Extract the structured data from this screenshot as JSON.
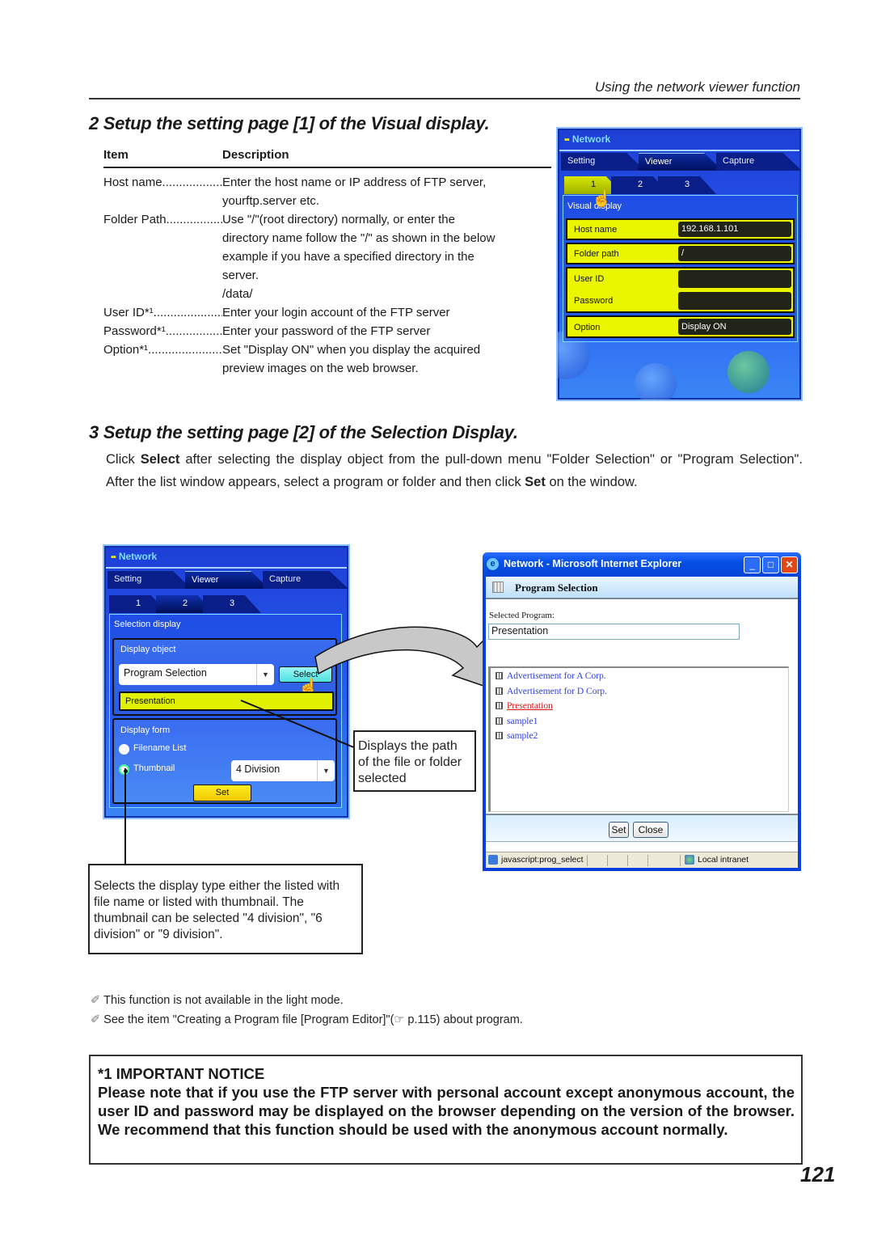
{
  "header": {
    "running_head": "Using the network viewer function"
  },
  "section2": {
    "title": "2 Setup the setting page [1] of the Visual display.",
    "table": {
      "headers": [
        "Item",
        "Description"
      ],
      "rows": [
        {
          "item": "Host name",
          "lines": [
            "Enter the host name or IP address of FTP server,",
            "yourftp.server etc."
          ]
        },
        {
          "item": "Folder Path",
          "lines": [
            "Use \"/\"(root directory) normally, or enter the",
            "directory name follow the \"/\" as shown in the below",
            "example if you have a specified directory in the",
            "server.",
            "/data/"
          ]
        },
        {
          "item": "User ID*¹",
          "lines": [
            "Enter your login account of the FTP server"
          ]
        },
        {
          "item": "Password*¹",
          "lines": [
            "Enter your password of the FTP server"
          ]
        },
        {
          "item": "Option*¹",
          "lines": [
            "Set \"Display ON\" when you display the acquired",
            "preview images on the web browser."
          ]
        }
      ]
    },
    "panel": {
      "title": "Network",
      "tabs": [
        "Setting",
        "Viewer",
        "Capture"
      ],
      "active_tab": "Viewer",
      "subtabs": [
        "1",
        "2",
        "3"
      ],
      "active_subtab": "1",
      "section_label": "Visual display",
      "fields": [
        {
          "label": "Host name",
          "value": "192.168.1.101"
        },
        {
          "label": "Folder path",
          "value": "/"
        },
        {
          "label": "User ID",
          "value": ""
        },
        {
          "label": "Password",
          "value": ""
        },
        {
          "label": "Option",
          "value": "Display ON"
        }
      ]
    }
  },
  "section3": {
    "title": "3 Setup the setting page [2] of the Selection Display.",
    "paragraph": {
      "p1": "Click ",
      "b1": "Select",
      "p2": " after selecting the display object from the pull-down menu \"Folder Selection\" or \"Program Selection\". After the list window appears, select a program or folder and then click ",
      "b2": "Set",
      "p3": " on the window."
    },
    "panel": {
      "title": "Network",
      "tabs": [
        "Setting",
        "Viewer",
        "Capture"
      ],
      "active_tab": "Viewer",
      "subtabs": [
        "1",
        "2",
        "3"
      ],
      "active_subtab": "2",
      "section_label": "Selection display",
      "display_object_label": "Display object",
      "display_object_value": "Program Selection",
      "select_button": "Select",
      "path_value": "Presentation",
      "display_form_label": "Display form",
      "radio_filename": "Filename List",
      "radio_thumbnail": "Thumbnail",
      "selected_radio": "Thumbnail",
      "division_value": "4 Division",
      "set_button": "Set"
    },
    "callout_path": "Displays the path of the file or folder selected",
    "callout_display": "Selects the display type either the listed with file name or listed with thumbnail. The thumbnail can be selected \"4 division\", \"6 division\" or \"9 division\".",
    "ie_window": {
      "title": "Network - Microsoft Internet Explorer",
      "heading": "Program Selection",
      "selected_label": "Selected Program:",
      "selected_value": "Presentation",
      "items": [
        "Advertisement for A Corp.",
        "Advertisement for D Corp.",
        "Presentation",
        "sample1",
        "sample2"
      ],
      "selected_item": "Presentation",
      "set_button": "Set",
      "close_button": "Close",
      "status_text": "javascript:prog_select",
      "zone_text": "Local intranet"
    }
  },
  "notes": [
    "This function is not available in the light mode.",
    "See the item \"Creating a Program file [Program Editor]\"(☞ p.115)  about program."
  ],
  "notice": {
    "title": "*1 IMPORTANT NOTICE",
    "body": "Please note that if you use the FTP server with personal account except anonymous account, the user ID and password may be displayed on the browser depending on the version of the browser. We recommend that this function should be used with the anonymous account normally."
  },
  "page_number": "121"
}
